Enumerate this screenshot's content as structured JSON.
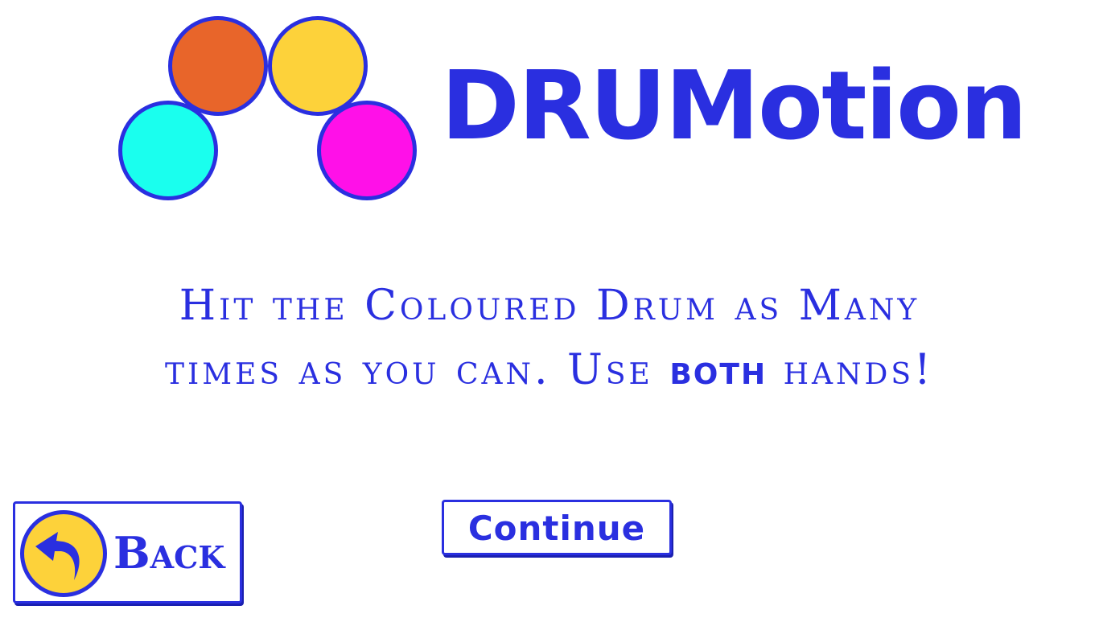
{
  "logo": {
    "drums": [
      {
        "name": "orange",
        "color": "#e8652a"
      },
      {
        "name": "yellow",
        "color": "#fdd23a"
      },
      {
        "name": "cyan",
        "color": "#1affee"
      },
      {
        "name": "magenta",
        "color": "#ff10e8"
      }
    ],
    "outline_color": "#2a2fe0"
  },
  "app_title": "DRUMotion",
  "instructions": {
    "line1": "Hit the Coloured Drum as Many",
    "line2_prefix": "times as you can. Use ",
    "line2_emphasis": "both",
    "line2_suffix": " hands!"
  },
  "buttons": {
    "back_label": "Back",
    "back_icon": "back-arrow-icon",
    "continue_label": "Continue"
  },
  "colors": {
    "accent": "#2a2fe0",
    "background": "#ffffff",
    "back_icon_fill": "#fdd23a"
  }
}
